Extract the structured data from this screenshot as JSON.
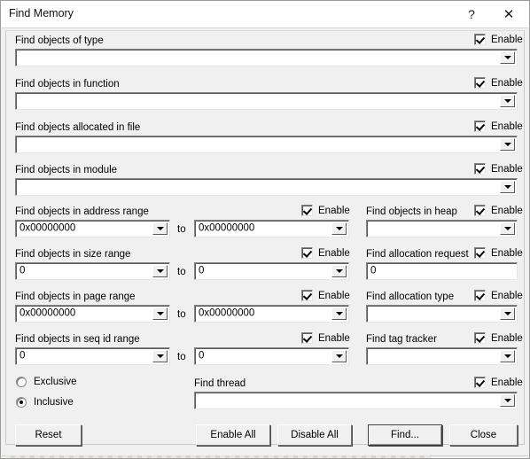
{
  "window": {
    "title": "Find Memory",
    "help_icon": "?",
    "close_icon": "✕"
  },
  "common": {
    "enable_label": "Enable",
    "to_label": "to"
  },
  "full_rows": [
    {
      "label": "Find objects of type",
      "value": "",
      "enable": true
    },
    {
      "label": "Find objects in function",
      "value": "",
      "enable": true
    },
    {
      "label": "Find objects allocated in file",
      "value": "",
      "enable": true
    },
    {
      "label": "Find objects in module",
      "value": "",
      "enable": true
    }
  ],
  "range_rows": [
    {
      "label": "Find objects in address range",
      "from": "0x00000000",
      "to": "0x00000000",
      "enable": true
    },
    {
      "label": "Find objects in size range",
      "from": "0",
      "to": "0",
      "enable": true
    },
    {
      "label": "Find objects in page range",
      "from": "0x00000000",
      "to": "0x00000000",
      "enable": true
    },
    {
      "label": "Find objects in seq id range",
      "from": "0",
      "to": "0",
      "enable": true
    }
  ],
  "right_rows": [
    {
      "label": "Find objects in heap",
      "value": "",
      "enable": true,
      "combo": true
    },
    {
      "label": "Find allocation request",
      "value": "0",
      "enable": true,
      "combo": false
    },
    {
      "label": "Find allocation type",
      "value": "",
      "enable": true,
      "combo": true
    },
    {
      "label": "Find tag tracker",
      "value": "",
      "enable": true,
      "combo": true
    }
  ],
  "scope": {
    "exclusive_label": "Exclusive",
    "inclusive_label": "Inclusive",
    "selected": "Inclusive"
  },
  "thread": {
    "label": "Find thread",
    "value": "",
    "enable": true
  },
  "buttons": {
    "reset": "Reset",
    "enable_all": "Enable All",
    "disable_all": "Disable All",
    "find": "Find...",
    "close": "Close"
  }
}
